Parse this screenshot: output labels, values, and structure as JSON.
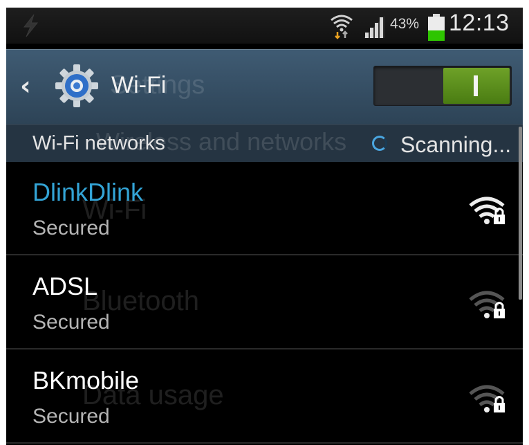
{
  "status_bar": {
    "battery_percent": "43%",
    "time": "12:13",
    "battery_level": 0.43,
    "icons": [
      "charging-icon",
      "wifi-transfer-icon",
      "cell-signal-icon",
      "battery-icon"
    ]
  },
  "action_bar": {
    "title": "Wi-Fi",
    "back_icon": "chevron-left-icon",
    "app_icon": "gear-icon",
    "wifi_switch_on": true
  },
  "section": {
    "title": "Wi-Fi networks",
    "scanning_label": "Scanning..."
  },
  "networks": [
    {
      "name": "DlinkDlink",
      "status": "Secured",
      "connected": true,
      "signal_bars": 4,
      "locked": true
    },
    {
      "name": "ADSL",
      "status": "Secured",
      "connected": false,
      "signal_bars": 1,
      "locked": true
    },
    {
      "name": "BKmobile",
      "status": "Secured",
      "connected": false,
      "signal_bars": 1,
      "locked": true
    }
  ],
  "background_ghost": {
    "items": [
      "Wi-Fi",
      "Bluetooth",
      "Data usage"
    ],
    "header": "Wireless and networks",
    "title": "Settings"
  },
  "colors": {
    "accent": "#33a4d6",
    "switch_on": "#5b8f1c",
    "action_bar": "#35506a"
  }
}
